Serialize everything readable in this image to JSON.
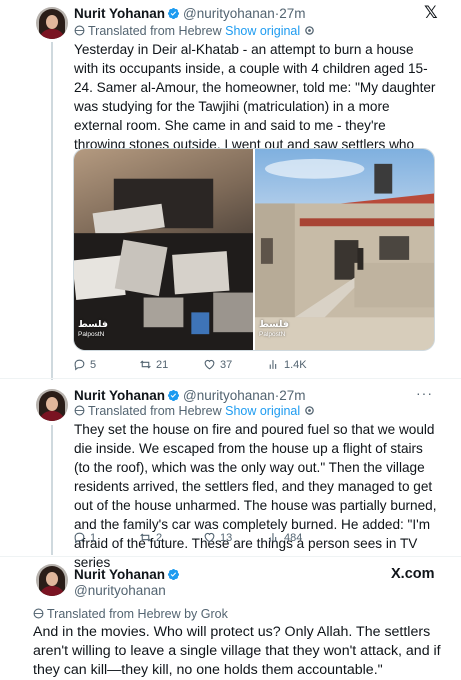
{
  "tweets": [
    {
      "name": "Nurit Yohanan",
      "handle": "@nurityohanan",
      "dot": "·",
      "time": "27m",
      "translated": "Translated from Hebrew",
      "show_original": "Show original",
      "text": "Yesterday in Deir al-Khatab - an attempt to burn a house with its occupants inside, a couple with 4 children aged 15-24. Samer al-Amour, the homeowner, told me: \"My daughter was studying for the Tawjihi (matriculation) in a more external room. She came in and said to me - they're throwing stones outside, I went out and saw settlers who had surrounded the house, we closed the door. They threw bottles of -->",
      "media_watermark_left": "فلسط",
      "media_watermark_left_sub": "PalpostN",
      "media_watermark_right": "فلسط",
      "media_watermark_right_sub": "PalpostN",
      "stats": {
        "replies": "5",
        "reposts": "21",
        "likes": "37",
        "views": "1.4K"
      },
      "icon": "x-logo-icon"
    },
    {
      "name": "Nurit Yohanan",
      "handle": "@nurityohanan",
      "dot": "·",
      "time": "27m",
      "translated": "Translated from Hebrew",
      "show_original": "Show original",
      "more": "···",
      "text": "They set the house on fire and poured fuel so that we would die inside. We escaped from the house up a flight of stairs (to the roof), which was the only way out.\" Then the village residents arrived, the settlers fled, and they managed to get out of the house unharmed. The house was partially burned, and the family's car was completely burned. He added: \"I'm afraid of the future. These are things a person sees in TV series",
      "stats": {
        "replies": "1",
        "reposts": "2",
        "likes": "13",
        "views": "484"
      }
    },
    {
      "name": "Nurit Yohanan",
      "handle": "@nurityohanan",
      "brand": "X.com",
      "translated": "Translated from Hebrew by Grok",
      "text": "And in the movies. Who will protect us? Only Allah. The settlers aren't willing to leave a single village that they won't attack, and if they can kill—they kill, no one holds them accountable.\""
    }
  ],
  "colors": {
    "accent": "#1d9bf0",
    "muted": "#536471",
    "text": "#0f1419"
  }
}
